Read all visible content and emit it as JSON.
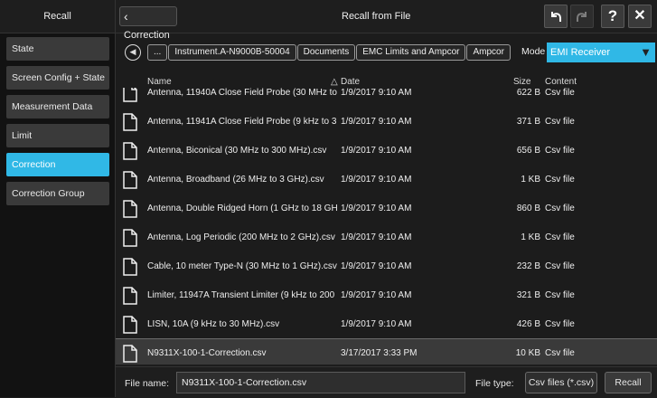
{
  "left_panel": {
    "title": "Recall",
    "items": [
      {
        "label": "State"
      },
      {
        "label": "Screen Config + State"
      },
      {
        "label": "Measurement Data"
      },
      {
        "label": "Limit"
      },
      {
        "label": "Correction"
      },
      {
        "label": "Correction Group"
      }
    ],
    "selected_index": 4
  },
  "topbar": {
    "back_label": "Correction",
    "title": "Recall from File",
    "help_label": "?",
    "close_label": "✕"
  },
  "pathbar": {
    "nav_glyph": "◀",
    "crumbs": [
      "...",
      "Instrument.A-N9000B-50004",
      "Documents",
      "EMC Limits and Ampcor",
      "Ampcor"
    ],
    "mode_label": "Mode",
    "mode_value": "EMI Receiver",
    "mode_arrow": "▼"
  },
  "table": {
    "headers": {
      "name": "Name",
      "sort_glyph": "△",
      "date": "Date",
      "size": "Size",
      "content": "Content"
    },
    "rows": [
      {
        "name": "Antenna, 11940A Close Field Probe (30 MHz to",
        "date": "1/9/2017 9:10 AM",
        "size": "622 B",
        "content": "Csv file"
      },
      {
        "name": "Antenna, 11941A Close Field Probe (9 kHz to 3",
        "date": "1/9/2017 9:10 AM",
        "size": "371 B",
        "content": "Csv file"
      },
      {
        "name": "Antenna, Biconical (30 MHz to 300 MHz).csv",
        "date": "1/9/2017 9:10 AM",
        "size": "656 B",
        "content": "Csv file"
      },
      {
        "name": "Antenna, Broadband (26 MHz to 3 GHz).csv",
        "date": "1/9/2017 9:10 AM",
        "size": "1 KB",
        "content": "Csv file"
      },
      {
        "name": "Antenna, Double Ridged Horn (1 GHz to 18 GH",
        "date": "1/9/2017 9:10 AM",
        "size": "860 B",
        "content": "Csv file"
      },
      {
        "name": "Antenna, Log Periodic (200 MHz to 2 GHz).csv",
        "date": "1/9/2017 9:10 AM",
        "size": "1 KB",
        "content": "Csv file"
      },
      {
        "name": "Cable, 10 meter Type-N (30 MHz to 1 GHz).csv",
        "date": "1/9/2017 9:10 AM",
        "size": "232 B",
        "content": "Csv file"
      },
      {
        "name": "Limiter, 11947A Transient Limiter (9 kHz to 200",
        "date": "1/9/2017 9:10 AM",
        "size": "321 B",
        "content": "Csv file"
      },
      {
        "name": "LISN, 10A (9 kHz to 30 MHz).csv",
        "date": "1/9/2017 9:10 AM",
        "size": "426 B",
        "content": "Csv file"
      },
      {
        "name": "N9311X-100-1-Correction.csv",
        "date": "3/17/2017 3:33 PM",
        "size": "10 KB",
        "content": "Csv file"
      }
    ],
    "selected_index": 9
  },
  "bottom": {
    "file_name_label": "File name:",
    "file_name_value": "N9311X-100-1-Correction.csv",
    "file_type_label": "File type:",
    "file_type_value": "Csv files (*.csv)",
    "recall_label": "Recall"
  },
  "colors": {
    "accent": "#30b8e6",
    "background": "#1c1c1c"
  },
  "icons": [
    "chevron-left-icon",
    "undo-icon",
    "redo-icon",
    "help-icon",
    "close-icon",
    "back-circle-icon",
    "file-icon",
    "dropdown-arrow-icon"
  ]
}
